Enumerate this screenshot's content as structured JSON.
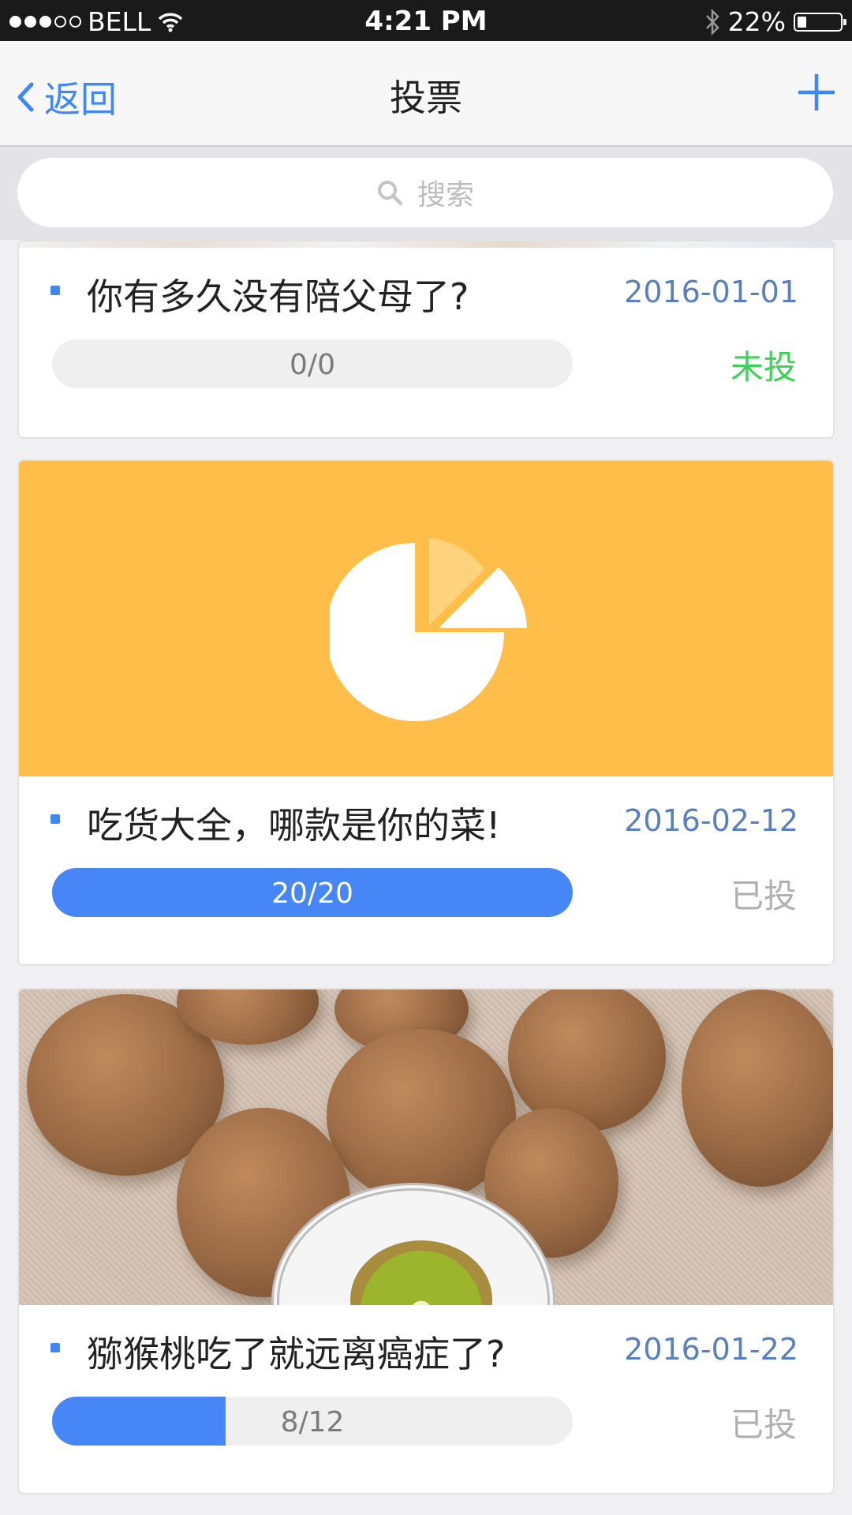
{
  "status_bar": {
    "carrier": "BELL",
    "time": "4:21 PM",
    "battery": "22%",
    "battery_level": 0.22
  },
  "nav": {
    "back_label": "返回",
    "title": "投票"
  },
  "search": {
    "placeholder": "搜索"
  },
  "colors": {
    "accent": "#3f87f5",
    "cover_orange": "#ffbd4a",
    "pending_green": "#3fcf5a",
    "date_blue": "#5a7fbf"
  },
  "polls": [
    {
      "title": "你有多久没有陪父母了?",
      "date": "2016-01-01",
      "progress_label": "0/0",
      "progress": 0,
      "status": "未投"
    },
    {
      "title": "吃货大全，哪款是你的菜!",
      "date": "2016-02-12",
      "progress_label": "20/20",
      "progress": 1,
      "status": "已投"
    },
    {
      "title": "猕猴桃吃了就远离癌症了?",
      "date": "2016-01-22",
      "progress_label": "8/12",
      "progress": 0.3333,
      "status": "已投"
    }
  ]
}
